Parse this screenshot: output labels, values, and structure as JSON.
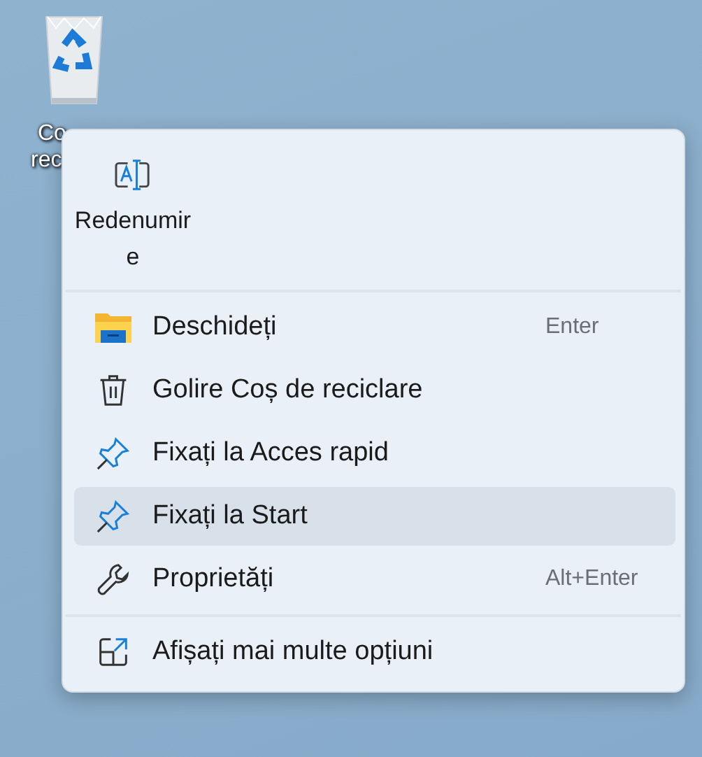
{
  "desktop_icon": {
    "label_lines": [
      "Co",
      "rec"
    ]
  },
  "context_menu": {
    "quick_actions": [
      {
        "kind": "rename",
        "label": "Redenumire"
      }
    ],
    "sections": [
      [
        {
          "kind": "folder",
          "label": "Deschideți",
          "shortcut": "Enter",
          "selected": false
        },
        {
          "kind": "trash",
          "label": "Golire Coș de reciclare",
          "selected": false
        },
        {
          "kind": "pin",
          "label": "Fixați la Acces rapid",
          "selected": false
        },
        {
          "kind": "pin",
          "label": "Fixați la Start",
          "selected": true
        },
        {
          "kind": "wrench",
          "label": "Proprietăți",
          "shortcut": "Alt+Enter",
          "selected": false
        }
      ],
      [
        {
          "kind": "expand",
          "label": "Afișați mai multe opțiuni",
          "selected": false
        }
      ]
    ]
  }
}
